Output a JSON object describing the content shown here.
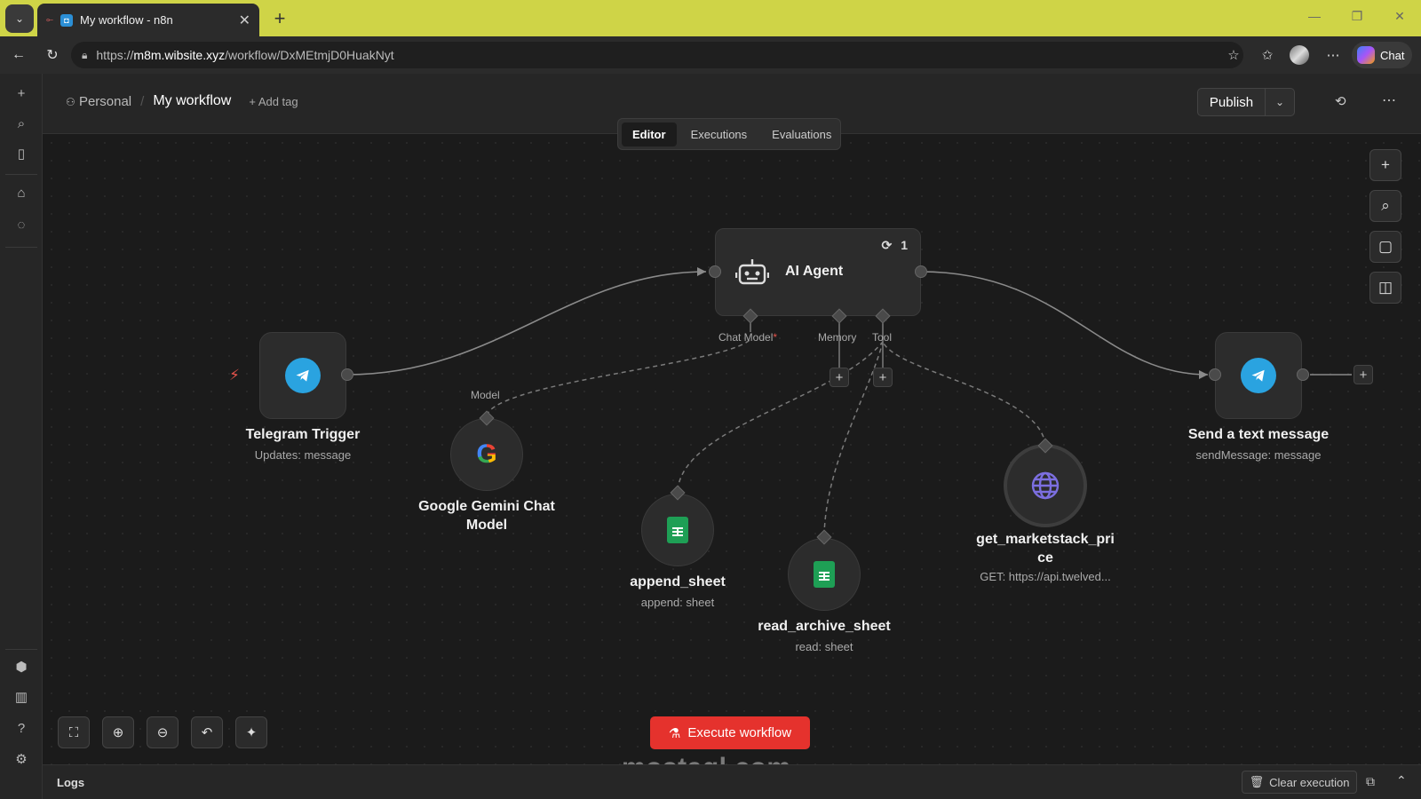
{
  "browser": {
    "tab_title": "My workflow - n8n",
    "tab_close": "✕",
    "new_tab": "+",
    "url_prefix": "https://",
    "url_host": "m8m.wibsite.xyz",
    "url_path": "/workflow/DxMEtmjD0HuakNyt",
    "chat_label": "Chat"
  },
  "header": {
    "breadcrumb_personal": "Personal",
    "breadcrumb_separator": "/",
    "workflow_name": "My workflow",
    "add_tag": "+ Add tag",
    "publish_label": "Publish"
  },
  "view_tabs": [
    "Editor",
    "Executions",
    "Evaluations"
  ],
  "nodes": {
    "telegram_trigger": {
      "title": "Telegram Trigger",
      "subtitle": "Updates: message"
    },
    "gemini": {
      "title_line1": "Google Gemini Chat",
      "title_line2": "Model",
      "port_label": "Model"
    },
    "ai_agent": {
      "title": "AI Agent",
      "run_count": "1",
      "port_chat_model": "Chat Model",
      "port_memory": "Memory",
      "port_tool": "Tool",
      "required_mark": "*"
    },
    "append_sheet": {
      "title": "append_sheet",
      "subtitle": "append: sheet"
    },
    "read_archive_sheet": {
      "title": "read_archive_sheet",
      "subtitle": "read: sheet"
    },
    "marketstack": {
      "title_line1": "get_marketstack_pri",
      "title_line2": "ce",
      "subtitle": "GET: https://api.twelved..."
    },
    "send_message": {
      "title": "Send a text message",
      "subtitle": "sendMessage: message"
    }
  },
  "footer": {
    "execute_label": "Execute workflow",
    "logs_label": "Logs",
    "clear_execution": "Clear execution",
    "watermark": "mostaql.com"
  },
  "colors": {
    "tabbar": "#cfd447",
    "execute": "#e5322d",
    "telegram": "#2aa3e0",
    "sheets": "#1e9f55",
    "globe": "#7c6fe0"
  }
}
